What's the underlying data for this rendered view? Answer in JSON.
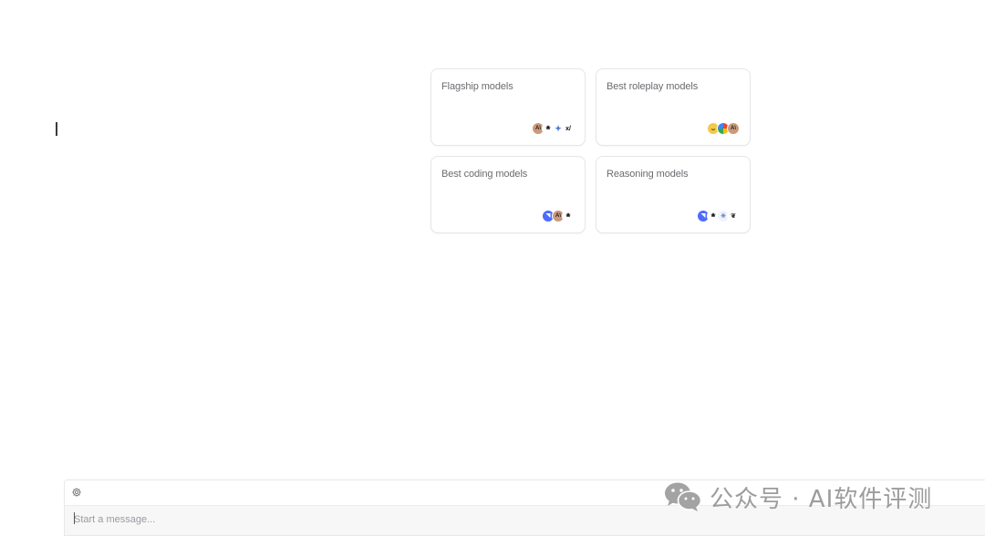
{
  "cards": [
    {
      "title": "Flagship models",
      "icons": [
        "anthropic-icon",
        "openai-icon",
        "gemini-icon",
        "xai-icon"
      ],
      "glyphs": [
        "A\\",
        "❀",
        "✦",
        "x/"
      ]
    },
    {
      "title": "Best roleplay models",
      "icons": [
        "happy-face-icon",
        "google-icon",
        "anthropic-icon"
      ],
      "glyphs": [
        "ᴗ",
        "",
        "A\\"
      ]
    },
    {
      "title": "Best coding models",
      "icons": [
        "deepseek-icon",
        "anthropic-icon",
        "openai-icon"
      ],
      "glyphs": [
        "◥",
        "A\\",
        "❀"
      ]
    },
    {
      "title": "Reasoning models",
      "icons": [
        "deepseek-icon",
        "openai-icon",
        "qwen-icon",
        "mistral-icon"
      ],
      "glyphs": [
        "◥",
        "❀",
        "✳",
        "❦"
      ]
    }
  ],
  "composer": {
    "placeholder": "Start a message...",
    "settings_icon": "gear-icon"
  },
  "watermark": {
    "text": "公众号 · AI软件评测",
    "icon": "wechat-icon"
  },
  "colors": {
    "anthropic": "#c99a7b",
    "deepseek": "#4d6bfe",
    "card_border": "#e6e6e9",
    "watermark": "#9c9c9c"
  }
}
